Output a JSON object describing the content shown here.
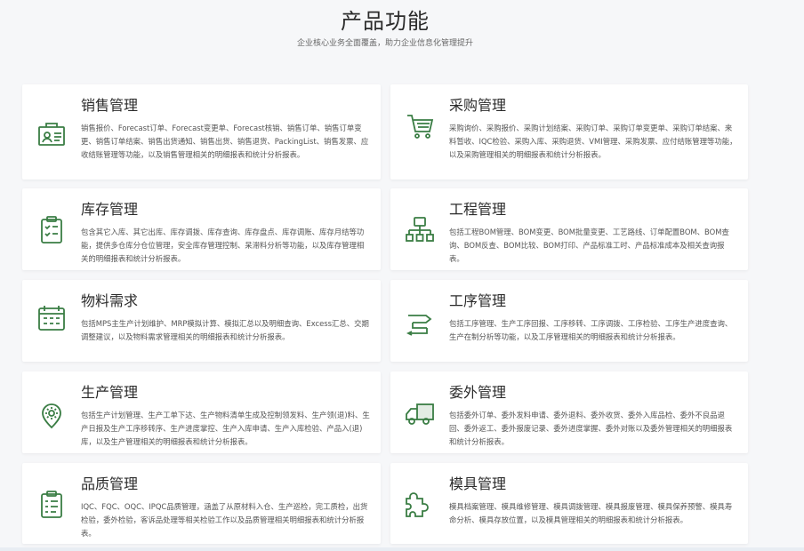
{
  "header": {
    "title": "产品功能",
    "subtitle": "企业核心业务全面覆盖，助力企业信息化管理提升"
  },
  "modules": [
    {
      "title": "销售管理",
      "icon": "sales-icon",
      "desc": "销售报价、Forecast订单、Forecast变更单、Forecast核销、销售订单、销售订单变更、销售订单结案、销售出货通知、销售出货、销售退货、PackingList、销售发票、应收结账管理等功能，以及销售管理相关的明细报表和统计分析报表。"
    },
    {
      "title": "采购管理",
      "icon": "cart-icon",
      "desc": "采购询价、采购报价、采购计划结案、采购订单、采购订单变更单、采购订单结案、来料暂收、IQC检验、采购入库、采购退货、VMI管理、采购发票、应付结账管理等功能，以及采购管理相关的明细报表和统计分析报表。"
    },
    {
      "title": "库存管理",
      "icon": "inventory-clipboard-icon",
      "desc": "包含其它入库、其它出库、库存调拨、库存查询、库存盘点、库存调账、库存月结等功能，提供多仓库分仓位管理，安全库存管理控制、呆滞料分析等功能，以及库存管理相关的明细报表和统计分析报表。"
    },
    {
      "title": "工程管理",
      "icon": "hierarchy-icon",
      "desc": "包括工程BOM管理、BOM变更、BOM批量变更、工艺路线、订单配置BOM、BOM查询、BOM反查、BOM比较、BOM打印、产品标准工时、产品标准成本及相关查询报表。"
    },
    {
      "title": "物料需求",
      "icon": "calendar-grid-icon",
      "desc": "包括MPS主生产计划维护、MRP模拟计算、模拟汇总以及明细查询、Excess汇总、交期调整建议，以及物料需求管理相关的明细报表和统计分析报表。"
    },
    {
      "title": "工序管理",
      "icon": "process-flow-icon",
      "desc": "包括工序管理、生产工序回报、工序移转、工序调拨、工序检验、工序生产进度查询、生产在制分析等功能，以及工序管理相关的明细报表和统计分析报表。"
    },
    {
      "title": "生产管理",
      "icon": "gear-pin-icon",
      "desc": "包括生产计划管理、生产工单下达、生产物料清单生成及控制领发料、生产领(退)料、生产日报及生产工序移转序、生产进度掌控、生产入库申请、生产入库检验、产品入(退)库，以及生产管理相关的明细报表和统计分析报表。"
    },
    {
      "title": "委外管理",
      "icon": "truck-icon",
      "desc": "包括委外订单、委外发料申请、委外退料、委外收货、委外入库品检、委外不良品退回、委外返工、委外报废记录、委外进度掌握、委外对账以及委外管理相关的明细报表和统计分析报表。"
    },
    {
      "title": "品质管理",
      "icon": "quality-clipboard-icon",
      "desc": "IQC、FQC、OQC、IPQC品质管理，涵盖了从原材料入仓、生产巡检，完工质检，出货检验，委外检验，客诉品处理等相关检验工作以及品质管理相关明细报表和统计分析报表。"
    },
    {
      "title": "模具管理",
      "icon": "puzzle-icon",
      "desc": "模具档案管理、模具维修管理、模具调拨管理、模具报废管理、模具保养预警、模具寿命分析、模具存放位置，以及模具管理相关的明细报表和统计分析报表。"
    }
  ],
  "colors": {
    "accent": "#3a7d44",
    "card_bg": "#ffffff",
    "page_bg": "#f6f7f9"
  }
}
